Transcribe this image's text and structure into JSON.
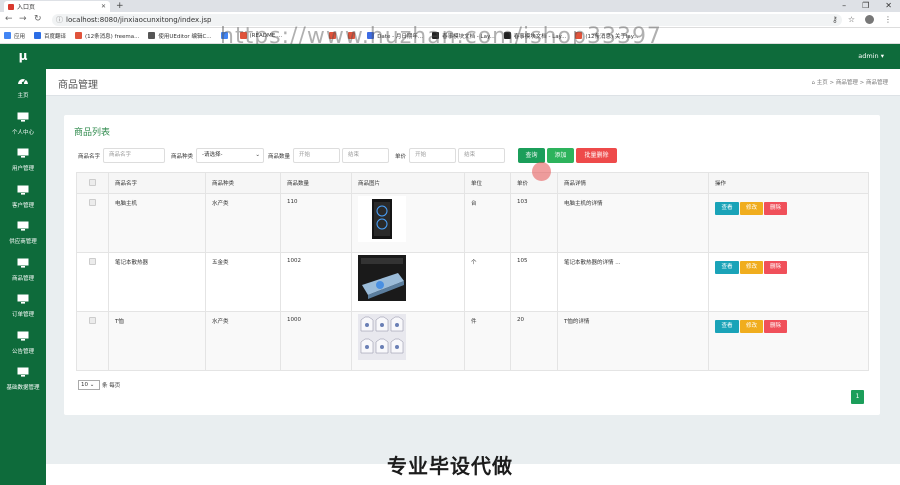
{
  "browser": {
    "tab_title": "入口页",
    "url": "localhost:8080/jinxiaocunxitong/index.jsp",
    "bookmarks": [
      {
        "label": "应用",
        "color": "#4285f4"
      },
      {
        "label": "百度翻译",
        "color": "#2b6de5"
      },
      {
        "label": "(12条消息) freema...",
        "color": "#e0533b"
      },
      {
        "label": "使用UEditor 编辑C...",
        "color": "#555555"
      },
      {
        "label": "",
        "color": "#4285f4"
      },
      {
        "label": "(README ...",
        "color": "#e0533b"
      },
      {
        "label": "",
        "color": "#ffffff"
      },
      {
        "label": "",
        "color": "#ffffff"
      },
      {
        "label": "",
        "color": "#e0533b"
      },
      {
        "label": "",
        "color": "#e0533b"
      },
      {
        "label": "Date - 月日期年...",
        "color": "#3d6ce4"
      },
      {
        "label": "春事模块文档 - Lay...",
        "color": "#222222"
      },
      {
        "label": "春事模块文档 - Lay...",
        "color": "#222222"
      },
      {
        "label": "(12条消息) 关于lay...",
        "color": "#e0533b"
      }
    ],
    "watermark": "https://www.huzhan.com/ishop33397"
  },
  "header": {
    "logo": "μ",
    "user": "admin ▾"
  },
  "sidebar": {
    "items": [
      {
        "label": "主页",
        "icon": "dashboard-icon"
      },
      {
        "label": "个人中心",
        "icon": "monitor-icon"
      },
      {
        "label": "用户管理",
        "icon": "monitor-icon"
      },
      {
        "label": "客户管理",
        "icon": "monitor-icon"
      },
      {
        "label": "供应商管理",
        "icon": "monitor-icon"
      },
      {
        "label": "商品管理",
        "icon": "monitor-icon"
      },
      {
        "label": "订单管理",
        "icon": "monitor-icon"
      },
      {
        "label": "公告管理",
        "icon": "monitor-icon"
      },
      {
        "label": "基础数据管理",
        "icon": "monitor-icon"
      }
    ]
  },
  "page": {
    "title": "商品管理",
    "breadcrumb": [
      "主页",
      "商品管理",
      "商品管理"
    ],
    "panel_title": "商品列表"
  },
  "filters": {
    "name_label": "商品名字",
    "name_placeholder": "商品名字",
    "type_label": "商品种类",
    "type_value": "-请选择-",
    "qty_label": "商品数量",
    "qty_start": "开始",
    "qty_end": "结束",
    "price_label": "单价",
    "price_start": "开始",
    "price_end": "结束",
    "search": "查询",
    "add": "添加",
    "batch_delete": "批量删除"
  },
  "table": {
    "headers": [
      "商品名字",
      "商品种类",
      "商品数量",
      "商品图片",
      "单位",
      "单价",
      "商品详情",
      "操作"
    ],
    "rows": [
      {
        "name": "电脑主机",
        "type": "水产类",
        "qty": "110",
        "image": "pc-case",
        "unit": "台",
        "price": "103",
        "detail": "电脑主机的详情"
      },
      {
        "name": "笔记本散热器",
        "type": "五金类",
        "qty": "1002",
        "image": "laptop-cooler",
        "unit": "个",
        "price": "105",
        "detail": "笔记本散热器的详情 ..."
      },
      {
        "name": "T恤",
        "type": "水产类",
        "qty": "1000",
        "image": "tshirts",
        "unit": "件",
        "price": "20",
        "detail": "T恤的详情"
      }
    ],
    "actions": {
      "view": "查看",
      "edit": "修改",
      "delete": "删除"
    }
  },
  "pagination": {
    "page_size": "10",
    "per_page_label": "条 每页",
    "current_page": "1"
  },
  "overlay_text": "专业毕设代做",
  "colors": {
    "primary": "#0e6b3b",
    "view": "#1aa3b8",
    "edit": "#f0ad1e",
    "delete": "#f0505a",
    "search": "#1b9e5a",
    "batch_delete": "#ee4a4a"
  }
}
